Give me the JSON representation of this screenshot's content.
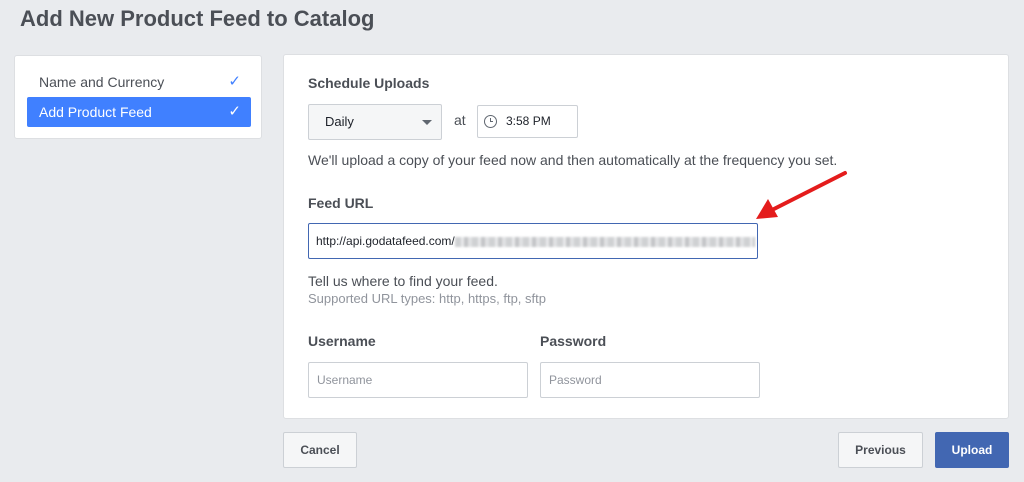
{
  "page": {
    "title": "Add New Product Feed to Catalog"
  },
  "steps": [
    {
      "label": "Name and Currency",
      "check": "✓"
    },
    {
      "label": "Add Product Feed",
      "check": "✓"
    }
  ],
  "schedule": {
    "label": "Schedule Uploads",
    "frequency": "Daily",
    "at_label": "at",
    "time": "3:58 PM",
    "note": "We'll upload a copy of your feed now and then automatically at the frequency you set."
  },
  "feed": {
    "label": "Feed URL",
    "url_value": "http://api.godatafeed.com/",
    "help": "Tell us where to find your feed.",
    "supported": "Supported URL types: http, https, ftp, sftp"
  },
  "credentials": {
    "username_label": "Username",
    "username_placeholder": "Username",
    "password_label": "Password",
    "password_placeholder": "Password"
  },
  "buttons": {
    "cancel": "Cancel",
    "previous": "Previous",
    "upload": "Upload"
  },
  "colors": {
    "accent": "#4080ff",
    "primary_button": "#4267b2",
    "annotation_arrow": "#e41c1c"
  }
}
